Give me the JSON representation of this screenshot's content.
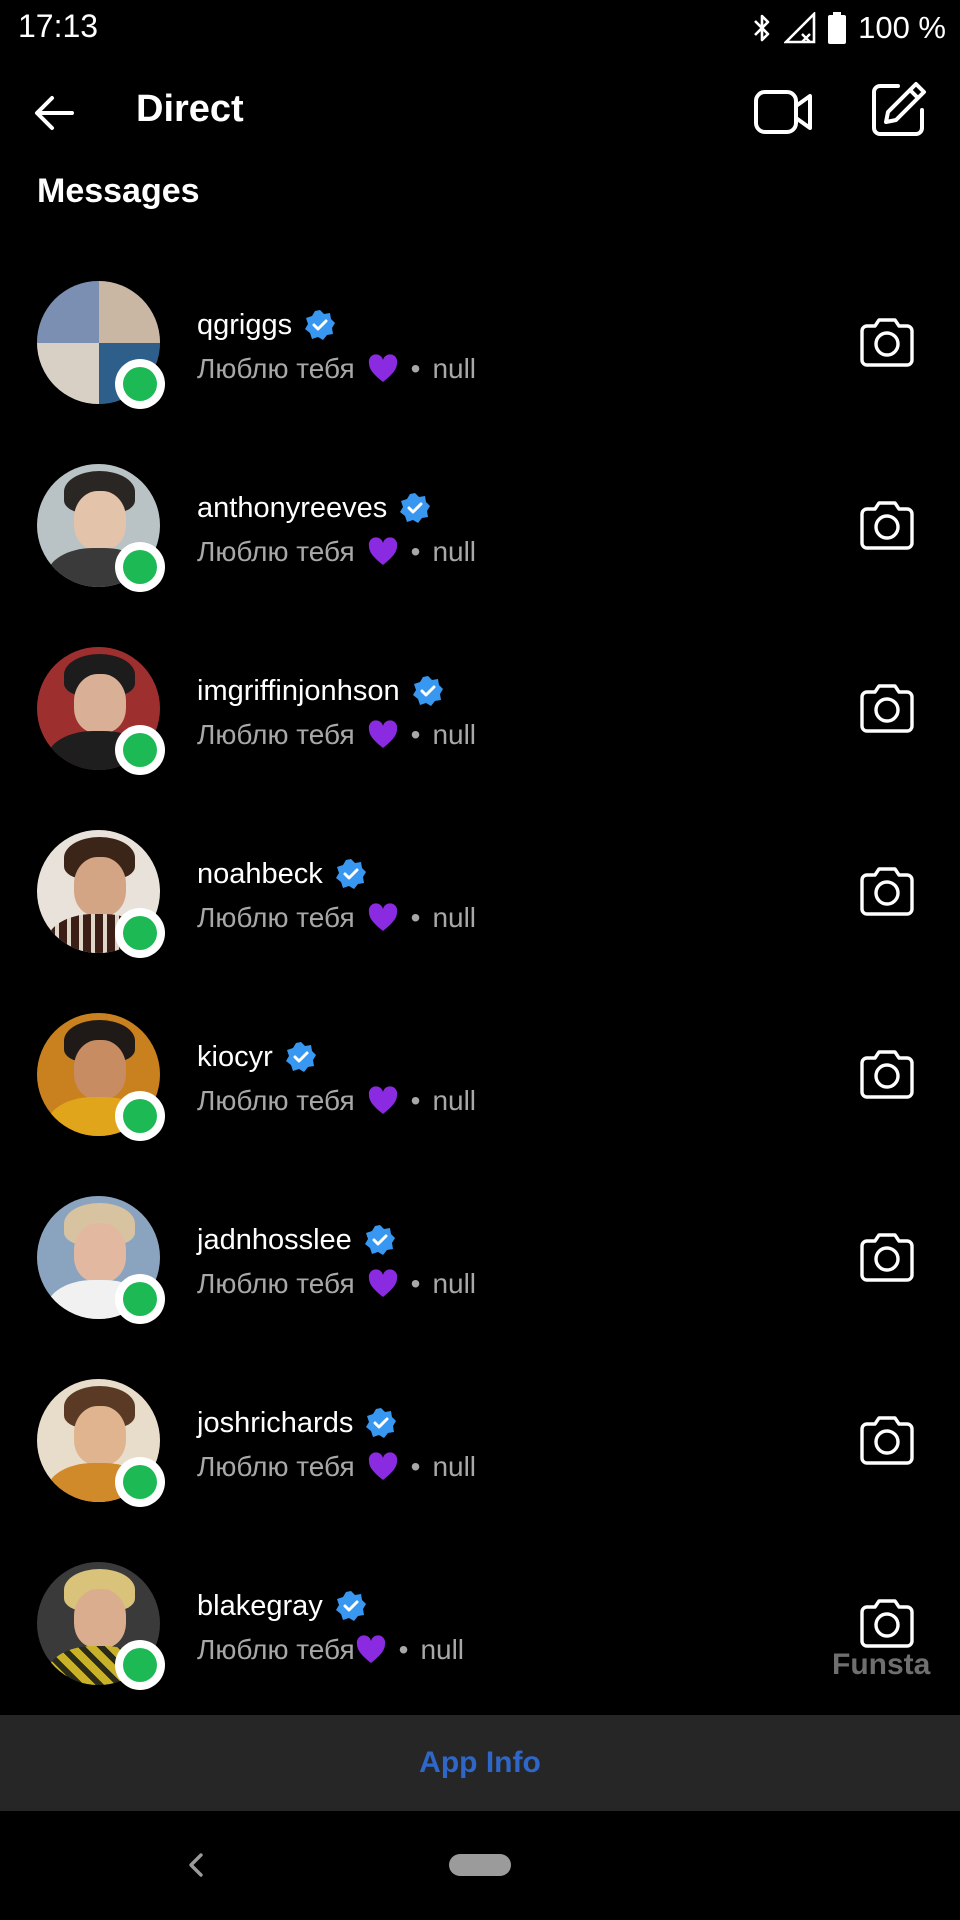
{
  "status_bar": {
    "time": "17:13",
    "battery_text": "100 %",
    "icons": [
      "bluetooth-icon",
      "signal-icon",
      "battery-icon"
    ]
  },
  "header": {
    "title": "Direct",
    "icons": [
      "back-arrow-icon",
      "video-camera-icon",
      "compose-icon"
    ]
  },
  "section": {
    "title": "Messages"
  },
  "colors": {
    "background": "#000000",
    "online": "#1db954",
    "verified": "#3897f0",
    "heart": "#8a2be2",
    "secondary_text": "#a8a8a8",
    "app_info_bar": "#262626",
    "app_info_text": "#2f67c8"
  },
  "threads": [
    {
      "username": "qgriggs",
      "preview": "Люблю тебя",
      "separator": "•",
      "time": "null",
      "verified": true,
      "online": true
    },
    {
      "username": "anthonyreeves",
      "preview": "Люблю тебя",
      "separator": "•",
      "time": "null",
      "verified": true,
      "online": true
    },
    {
      "username": "imgriffinjonhson",
      "preview": "Люблю тебя",
      "separator": "•",
      "time": "null",
      "verified": true,
      "online": true
    },
    {
      "username": "noahbeck",
      "preview": "Люблю тебя",
      "separator": "•",
      "time": "null",
      "verified": true,
      "online": true
    },
    {
      "username": "kiocyr",
      "preview": "Люблю тебя",
      "separator": "•",
      "time": "null",
      "verified": true,
      "online": true
    },
    {
      "username": "jadnhosslee",
      "preview": "Люблю тебя",
      "separator": "•",
      "time": "null",
      "verified": true,
      "online": true
    },
    {
      "username": "joshrichards",
      "preview": "Люблю тебя",
      "separator": "•",
      "time": "null",
      "verified": true,
      "online": true
    },
    {
      "username": "blakegray",
      "preview": "Люблю тебя",
      "separator": "•",
      "time": "null",
      "verified": true,
      "online": true
    }
  ],
  "watermark": "Funsta",
  "app_info": {
    "label": "App Info"
  }
}
